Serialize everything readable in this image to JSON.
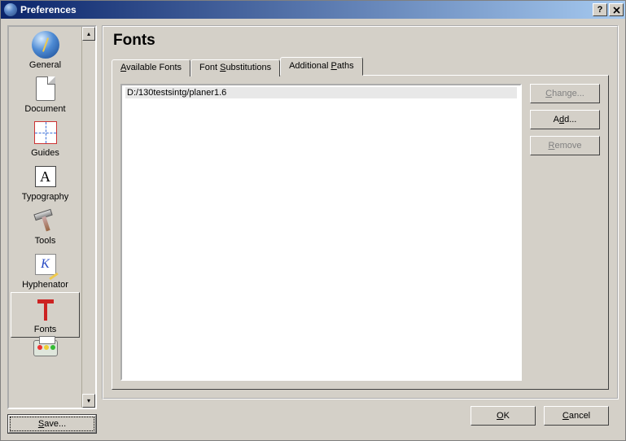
{
  "window": {
    "title": "Preferences"
  },
  "sidebar": {
    "items": [
      {
        "label": "General"
      },
      {
        "label": "Document"
      },
      {
        "label": "Guides"
      },
      {
        "label": "Typography"
      },
      {
        "label": "Tools"
      },
      {
        "label": "Hyphenator"
      },
      {
        "label": "Fonts",
        "selected": true
      },
      {
        "label": ""
      }
    ],
    "save_label": "Save..."
  },
  "main": {
    "heading": "Fonts",
    "tabs": [
      {
        "label_pre": "",
        "label_u": "A",
        "label_post": "vailable Fonts"
      },
      {
        "label_pre": "Font ",
        "label_u": "S",
        "label_post": "ubstitutions"
      },
      {
        "label_pre": "Additional ",
        "label_u": "P",
        "label_post": "aths"
      }
    ],
    "paths": [
      "D:/130testsintg/planer1.6"
    ],
    "buttons": {
      "change": {
        "u": "C",
        "rest": "hange..."
      },
      "add": {
        "pre": "A",
        "u": "d",
        "rest": "d..."
      },
      "remove": {
        "u": "R",
        "rest": "emove"
      }
    }
  },
  "footer": {
    "ok": {
      "u": "O",
      "rest": "K"
    },
    "cancel": {
      "u": "C",
      "rest": "ancel"
    }
  }
}
